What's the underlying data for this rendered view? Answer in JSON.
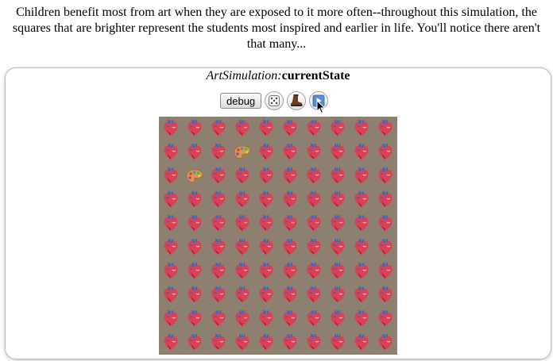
{
  "intro": {
    "text": "Children benefit most from art when they are exposed to it more often--throughout this simulation, the squares that are brighter represent the students most inspired and earlier in life. You'll notice there aren't that many..."
  },
  "state": {
    "class_name": "ArtSimulation:",
    "property": "currentState"
  },
  "toolbar": {
    "debug_label": "debug",
    "buttons": [
      {
        "name": "randomize",
        "icon": "dice-icon"
      },
      {
        "name": "step",
        "icon": "boot-icon"
      },
      {
        "name": "play",
        "icon": "play-icon"
      }
    ]
  },
  "grid": {
    "rows": 10,
    "cols": 10,
    "background": "#8d8070",
    "legend": {
      "H": "anatomical-heart-icon",
      "P": "artist-palette-icon"
    },
    "cells": [
      "HHHHHHHHHH",
      "HHHPHHHHHH",
      "HPHHHHHHHH",
      "HHHHHHHHHH",
      "HHHHHHHHHH",
      "HHHHHHHHHH",
      "HHHHHHHHHH",
      "HHHHHHHHHH",
      "HHHHHHHHHH",
      "HHHHHHHHHH"
    ]
  }
}
